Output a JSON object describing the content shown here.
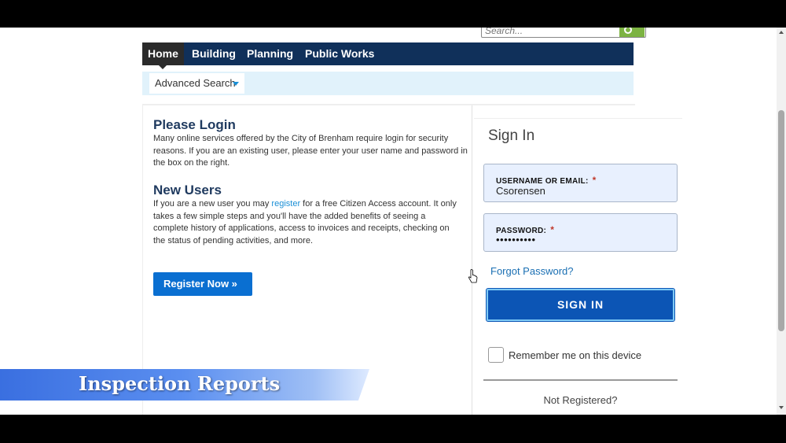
{
  "search": {
    "placeholder": "Search..."
  },
  "nav": {
    "items": [
      "Home",
      "Building",
      "Planning",
      "Public Works"
    ]
  },
  "subnav": {
    "advanced_search": "Advanced Search"
  },
  "login_info": {
    "title": "Please Login",
    "body": "Many online services offered by the City of Brenham require login for security reasons. If you are an existing user, please enter your user name and password in the box on the right."
  },
  "new_users": {
    "title": "New Users",
    "before_link": "If you are a new user you may ",
    "link": "register",
    "after_link": " for a free Citizen Access account. It only takes a few simple steps and you'll have the added benefits of seeing a complete history of applications, access to invoices and receipts, checking on the status of pending activities, and more.",
    "button": "Register Now »"
  },
  "signin": {
    "title": "Sign In",
    "username_label": "USERNAME OR EMAIL:",
    "username_value": "Csorensen",
    "password_label": "PASSWORD:",
    "password_mask": "••••••••••",
    "required_mark": "*",
    "forgot": "Forgot Password?",
    "button": "SIGN IN",
    "remember": "Remember me on this device",
    "not_registered": "Not Registered?"
  },
  "overlay": {
    "caption": "Inspection Reports"
  },
  "colors": {
    "nav_bg": "#10305a",
    "accent": "#0c55b5",
    "link": "#1a8fd6",
    "subnav_bg": "#e1f2fb"
  }
}
